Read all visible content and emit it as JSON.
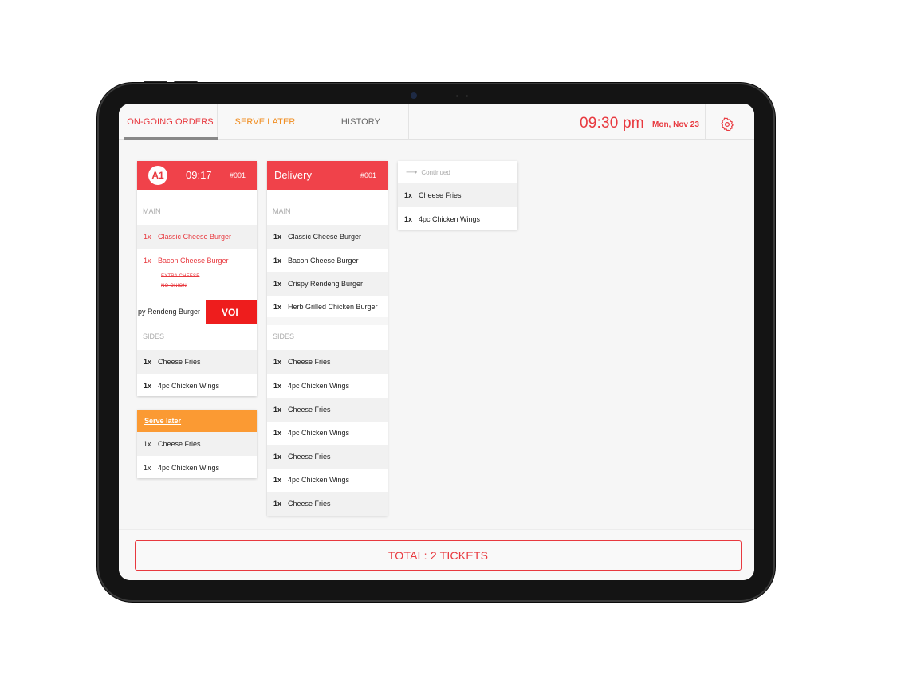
{
  "header": {
    "tabs": [
      {
        "label": "ON-GOING ORDERS"
      },
      {
        "label": "SERVE LATER"
      },
      {
        "label": "HISTORY"
      }
    ],
    "time": "09:30 pm",
    "date": "Mon, Nov 23",
    "settings_icon": "gear-icon"
  },
  "ticket1": {
    "table": "A1",
    "time": "09:17",
    "number": "#001",
    "main_label": "MAIN",
    "main_items": [
      {
        "qty": "1x",
        "name": "Classic Cheese Burger"
      },
      {
        "qty": "1x",
        "name": "Bacon Cheese Burger"
      }
    ],
    "modifiers": [
      "EXTRA CHEESE",
      "NO ONION"
    ],
    "swipe_item": "py Rendeng Burger",
    "void_label": "VOI",
    "sides_label": "SIDES",
    "side_items": [
      {
        "qty": "1x",
        "name": "Cheese Fries"
      },
      {
        "qty": "1x",
        "name": "4pc Chicken Wings"
      }
    ]
  },
  "serve_later_ticket": {
    "title": "Serve later",
    "items": [
      {
        "qty": "1x",
        "name": "Cheese Fries"
      },
      {
        "qty": "1x",
        "name": "4pc Chicken Wings"
      }
    ]
  },
  "ticket2": {
    "title": "Delivery",
    "number": "#001",
    "main_label": "MAIN",
    "main_items": [
      {
        "qty": "1x",
        "name": "Classic Cheese Burger"
      },
      {
        "qty": "1x",
        "name": "Bacon Cheese Burger"
      },
      {
        "qty": "1x",
        "name": "Crispy Rendeng Burger"
      },
      {
        "qty": "1x",
        "name": "Herb Grilled Chicken Burger"
      }
    ],
    "sides_label": "SIDES",
    "side_items": [
      {
        "qty": "1x",
        "name": "Cheese Fries"
      },
      {
        "qty": "1x",
        "name": "4pc Chicken Wings"
      },
      {
        "qty": "1x",
        "name": "Cheese Fries"
      },
      {
        "qty": "1x",
        "name": "4pc Chicken Wings"
      },
      {
        "qty": "1x",
        "name": "Cheese Fries"
      },
      {
        "qty": "1x",
        "name": "4pc Chicken Wings"
      },
      {
        "qty": "1x",
        "name": "Cheese Fries"
      }
    ]
  },
  "continued_ticket": {
    "label": "Continued",
    "items": [
      {
        "qty": "1x",
        "name": "Cheese Fries"
      },
      {
        "qty": "1x",
        "name": "4pc Chicken Wings"
      }
    ]
  },
  "footer": {
    "total_label": "TOTAL: 2 TICKETS"
  },
  "colors": {
    "accent_red": "#e8393f",
    "header_red": "#f0424a",
    "void_red": "#ee1d1d",
    "serve_later_orange": "#fb9a33"
  }
}
